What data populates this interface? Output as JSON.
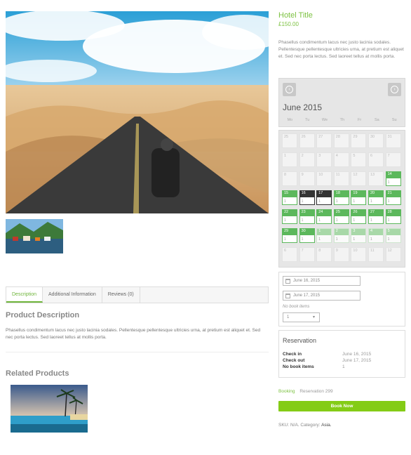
{
  "product": {
    "title": "Hotel Title",
    "price": "£150.00",
    "short_description": "Phasellus condimentum lacus nec justo lacinia sodales. Pellentesque pellentesque ultricies urna, at pretium est aliquet et. Sed nec porta lectus. Sed laoreet tellus at mollis porta."
  },
  "tabs": [
    {
      "label": "Description"
    },
    {
      "label": "Additional Information"
    },
    {
      "label": "Reviews (0)"
    }
  ],
  "description": {
    "title": "Product Description",
    "text": "Phasellus condimentum lacus nec justo lacinia sodales. Pellentesque pellentesque ultricies urna, at pretium est aliquet et. Sed nec porta lectus. Sed laoreet tellus at mollis porta."
  },
  "related": {
    "title": "Related Products"
  },
  "calendar": {
    "month_label": "June 2015",
    "weekdays": [
      "Mo",
      "Tu",
      "We",
      "Th",
      "Fr",
      "Sa",
      "Su"
    ],
    "weeks": [
      [
        {
          "d": "25",
          "s": "past"
        },
        {
          "d": "26",
          "s": "past"
        },
        {
          "d": "27",
          "s": "past"
        },
        {
          "d": "28",
          "s": "past"
        },
        {
          "d": "29",
          "s": "past"
        },
        {
          "d": "30",
          "s": "past"
        },
        {
          "d": "31",
          "s": "past"
        }
      ],
      [
        {
          "d": "1",
          "s": "past"
        },
        {
          "d": "2",
          "s": "past"
        },
        {
          "d": "3",
          "s": "past"
        },
        {
          "d": "4",
          "s": "past"
        },
        {
          "d": "5",
          "s": "past"
        },
        {
          "d": "6",
          "s": "past"
        },
        {
          "d": "7",
          "s": "past"
        }
      ],
      [
        {
          "d": "8",
          "s": "past"
        },
        {
          "d": "9",
          "s": "past"
        },
        {
          "d": "10",
          "s": "past"
        },
        {
          "d": "11",
          "s": "past"
        },
        {
          "d": "12",
          "s": "past"
        },
        {
          "d": "13",
          "s": "past"
        },
        {
          "d": "14",
          "s": "avail",
          "c": "1"
        }
      ],
      [
        {
          "d": "15",
          "s": "avail",
          "c": "1"
        },
        {
          "d": "16",
          "s": "sel",
          "c": "1"
        },
        {
          "d": "17",
          "s": "sel",
          "c": "1"
        },
        {
          "d": "18",
          "s": "avail",
          "c": "1"
        },
        {
          "d": "19",
          "s": "avail",
          "c": "1"
        },
        {
          "d": "20",
          "s": "avail",
          "c": "1"
        },
        {
          "d": "21",
          "s": "avail",
          "c": "1"
        }
      ],
      [
        {
          "d": "22",
          "s": "avail",
          "c": "1"
        },
        {
          "d": "23",
          "s": "avail",
          "c": "1"
        },
        {
          "d": "24",
          "s": "avail",
          "c": "1"
        },
        {
          "d": "25",
          "s": "avail",
          "c": "1"
        },
        {
          "d": "26",
          "s": "avail",
          "c": "1"
        },
        {
          "d": "27",
          "s": "avail",
          "c": "1"
        },
        {
          "d": "28",
          "s": "avail",
          "c": "1"
        }
      ],
      [
        {
          "d": "29",
          "s": "avail",
          "c": "1"
        },
        {
          "d": "30",
          "s": "avail",
          "c": "1"
        },
        {
          "d": "1",
          "s": "pale",
          "c": "1"
        },
        {
          "d": "2",
          "s": "pale",
          "c": "1"
        },
        {
          "d": "3",
          "s": "pale",
          "c": "1"
        },
        {
          "d": "4",
          "s": "pale",
          "c": "1"
        },
        {
          "d": "5",
          "s": "pale",
          "c": "1"
        }
      ],
      [
        {
          "d": "6",
          "s": "past"
        },
        {
          "d": "7",
          "s": "past"
        },
        {
          "d": "8",
          "s": "past"
        },
        {
          "d": "9",
          "s": "past"
        },
        {
          "d": "10",
          "s": "past"
        },
        {
          "d": "11",
          "s": "past"
        },
        {
          "d": "12",
          "s": "past"
        }
      ]
    ]
  },
  "form": {
    "check_in": "June 16, 2015",
    "check_out": "June 17, 2015",
    "no_book_items_label": "No book items",
    "no_book_items_value": "1"
  },
  "reservation": {
    "title": "Reservation",
    "rows": [
      {
        "k": "Check in",
        "v": "June 16, 2015"
      },
      {
        "k": "Check out",
        "v": "June 17, 2015"
      },
      {
        "k": "No book items",
        "v": "1"
      }
    ]
  },
  "booking": {
    "label": "Booking",
    "reservation_text": "Reservation 299"
  },
  "book_button": "Book Now",
  "sku": {
    "prefix": "SKU: N/A. Category: ",
    "category": "Asia."
  },
  "colors": {
    "accent": "#7dc242",
    "button": "#84cc16",
    "available": "#5cb85c",
    "selected": "#333333"
  }
}
